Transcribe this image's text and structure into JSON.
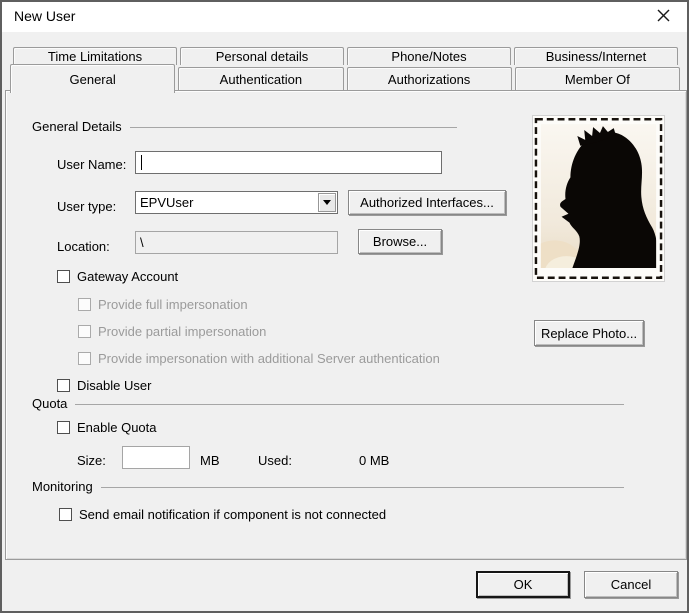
{
  "colors": {
    "dialog_bg": "#f0f0f0",
    "titlebar_bg": "#ffffff",
    "text": "#000000",
    "disabled_text": "#9b9b9b",
    "border": "#9b9b9b"
  },
  "titlebar": {
    "title": "New User",
    "close_icon": "×"
  },
  "tabs": {
    "back": [
      "Time Limitations",
      "Personal details",
      "Phone/Notes",
      "Business/Internet"
    ],
    "front": [
      "General",
      "Authentication",
      "Authorizations",
      "Member Of"
    ],
    "selected": "General"
  },
  "general": {
    "section": "General Details",
    "user_name_label": "User Name:",
    "user_name_value": "",
    "user_type_label": "User type:",
    "user_type_value": "EPVUser",
    "authorized_interfaces_button": "Authorized Interfaces...",
    "location_label": "Location:",
    "location_value": "\\",
    "browse_button": "Browse...",
    "gateway_account_label": "Gateway Account",
    "provide_full_label": "Provide full impersonation",
    "provide_partial_label": "Provide partial impersonation",
    "provide_additional_label": "Provide impersonation with additional Server authentication",
    "disable_user_label": "Disable User"
  },
  "quota": {
    "section": "Quota",
    "enable_quota_label": "Enable Quota",
    "size_label": "Size:",
    "size_value": "",
    "size_unit": "MB",
    "used_label": "Used:",
    "used_value": "0 MB"
  },
  "monitoring": {
    "section": "Monitoring",
    "send_email_label": "Send email notification if component is not connected"
  },
  "checkbox_states": {
    "gateway_account": false,
    "provide_full": false,
    "provide_partial": false,
    "provide_additional": false,
    "disable_user": false,
    "enable_quota": false,
    "send_email": false
  },
  "photo": {
    "replace_button": "Replace Photo..."
  },
  "footer": {
    "ok": "OK",
    "cancel": "Cancel"
  }
}
